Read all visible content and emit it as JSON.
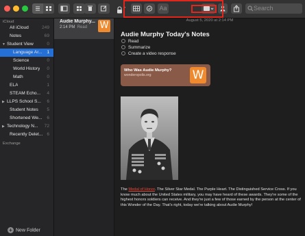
{
  "toolbar": {
    "search_placeholder": "Search",
    "attachment_glyph": "⊞",
    "text_style_label": "Aa"
  },
  "sidebar": {
    "sections": [
      {
        "header": "iCloud",
        "items": [
          {
            "label": "All iCloud",
            "count": "249"
          },
          {
            "label": "Notes",
            "count": "69"
          },
          {
            "label": "Student View",
            "count": "0",
            "disclosure": "▼"
          },
          {
            "label": "Language Ar...",
            "count": "1",
            "selected": true
          },
          {
            "label": "Science",
            "count": "0"
          },
          {
            "label": "World History",
            "count": "0"
          },
          {
            "label": "Math",
            "count": "0"
          },
          {
            "label": "ELA",
            "count": "1"
          },
          {
            "label": "STEAM Echo...",
            "count": "4"
          },
          {
            "label": "LLPS School S...",
            "count": "6",
            "disclosure": "▶"
          },
          {
            "label": "Student Notes",
            "count": "5"
          },
          {
            "label": "Shortened We...",
            "count": "6"
          },
          {
            "label": "Technology N...",
            "count": "72",
            "disclosure": "▶"
          },
          {
            "label": "Recently Delet...",
            "count": "6"
          }
        ]
      },
      {
        "header": "Exchange",
        "items": []
      }
    ],
    "new_folder_label": "New Folder"
  },
  "note_list": {
    "items": [
      {
        "title": "Audie Murphy...",
        "time": "2:14 PM",
        "preview": "Read",
        "thumb_glyph": "W"
      }
    ]
  },
  "note": {
    "date": "August 5, 2020 at 2:14 PM",
    "heading": "Audie Murphy Today's Notes",
    "checklist": [
      "Read",
      "Summarize",
      "Create a video response"
    ],
    "link_card": {
      "title": "Who Was Audie Murphy?",
      "url": "wonderopolis.org",
      "logo_glyph": "W"
    },
    "body": {
      "before": "The ",
      "link": "Medal of Honor",
      "after": ". The Silver Star Medal. The Purple Heart. The Distinguished Service Cross. If you know much about the United States military, you may have heard of these awards. They're some of the highest honors soldiers can receive. And they're just a few of those earned by the person at the center of this Wonder of the Day. That's right, today we're talking about Audie Murphy!"
    }
  },
  "colors": {
    "accent": "#2470d6",
    "highlight": "#e0261d",
    "link": "#e54a3c",
    "brand_orange": "#f08a2e",
    "card_bg": "#8a5a48"
  }
}
